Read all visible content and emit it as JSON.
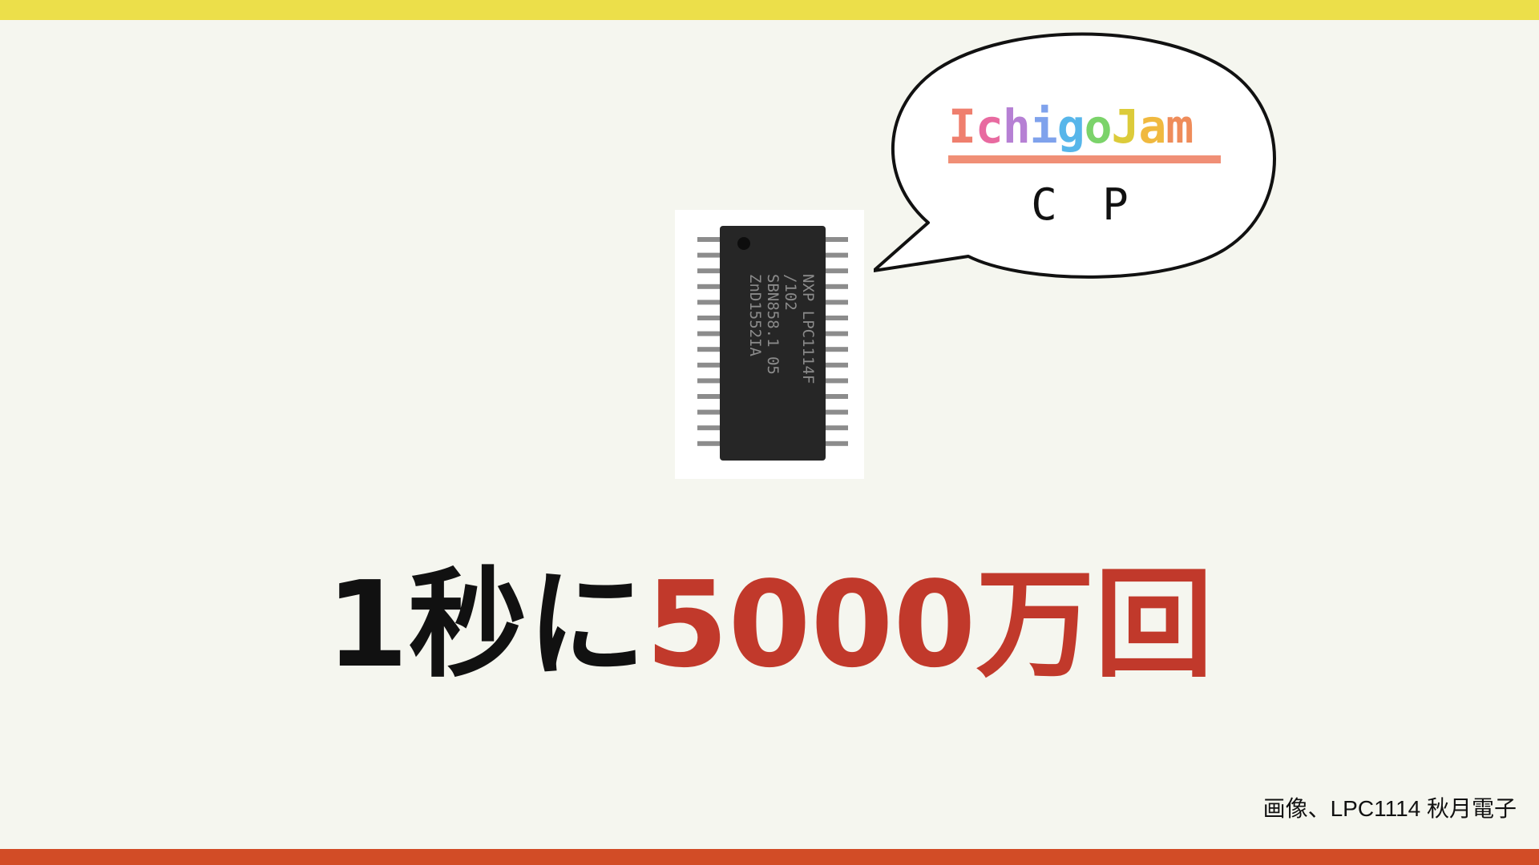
{
  "colors": {
    "top_bar": "#ecdf4a",
    "bottom_bar": "#d24c26",
    "background": "#f5f6ef",
    "headline_black": "#111111",
    "headline_red": "#c1392b"
  },
  "chip": {
    "marking_lines": [
      "NXP LPC1114F",
      "/102",
      "SBN858.1 05",
      "ZnD1552IA"
    ]
  },
  "speech_bubble": {
    "logo": {
      "letters": [
        {
          "char": "I",
          "color": "#ef7f6e"
        },
        {
          "char": "c",
          "color": "#e86aa0"
        },
        {
          "char": "h",
          "color": "#b680d4"
        },
        {
          "char": "i",
          "color": "#7fa2ec"
        },
        {
          "char": "g",
          "color": "#57b6ea"
        },
        {
          "char": "o",
          "color": "#7bd36a"
        },
        {
          "char": "J",
          "color": "#dccb3a"
        },
        {
          "char": "a",
          "color": "#f0b93f"
        },
        {
          "char": "m",
          "color": "#ef8c5a"
        }
      ],
      "bar_color": "#f08f76"
    },
    "text": "C P"
  },
  "headline": {
    "black_part": "1秒に",
    "red_part": "5000万回"
  },
  "credit": "画像、LPC1114 秋月電子"
}
